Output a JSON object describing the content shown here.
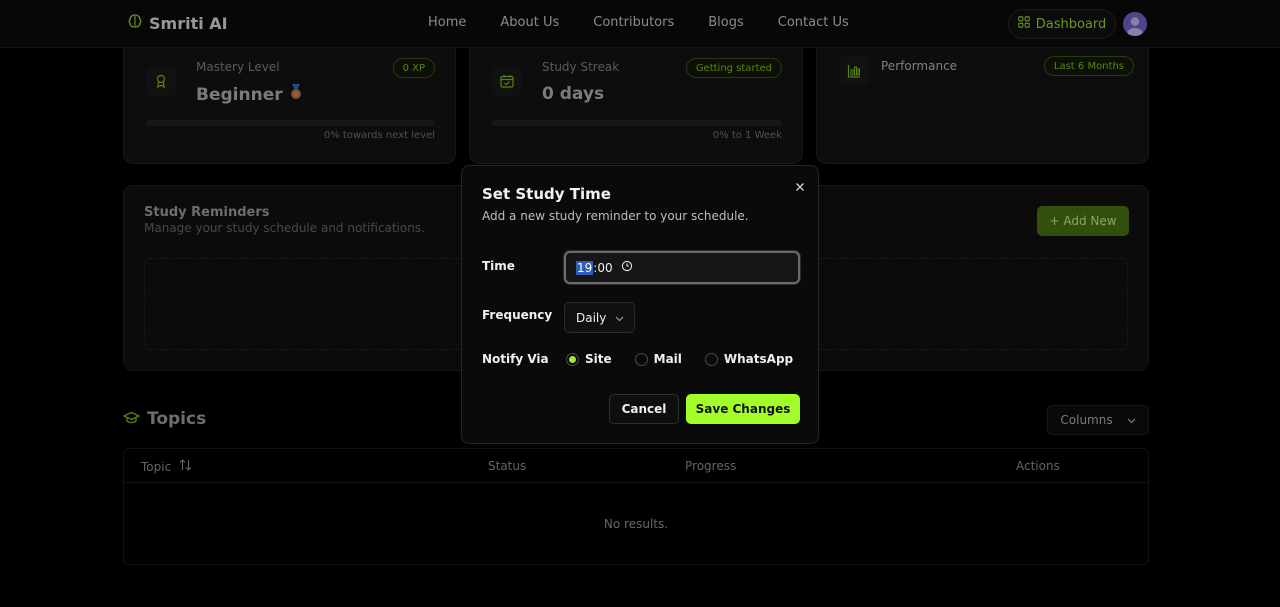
{
  "brand": {
    "name": "Smriti AI"
  },
  "nav": {
    "links": [
      "Home",
      "About Us",
      "Contributors",
      "Blogs",
      "Contact Us"
    ],
    "dashboard_label": "Dashboard"
  },
  "stats": {
    "mastery": {
      "label": "Mastery Level",
      "value": "Beginner",
      "badge": "0 XP",
      "progress": 0,
      "caption": "0% towards next level"
    },
    "streak": {
      "label": "Study Streak",
      "value": "0 days",
      "badge": "Getting started",
      "progress": 0,
      "caption": "0% to 1 Week"
    },
    "performance": {
      "label": "Performance",
      "badge": "Last 6 Months"
    }
  },
  "reminders": {
    "title": "Study Reminders",
    "subtitle": "Manage your study schedule and notifications.",
    "add_label": "+ Add New"
  },
  "topics": {
    "title": "Topics",
    "columns_label": "Columns",
    "headers": {
      "topic": "Topic",
      "status": "Status",
      "progress": "Progress",
      "actions": "Actions"
    },
    "empty": "No results."
  },
  "dialog": {
    "title": "Set Study Time",
    "description": "Add a new study reminder to your schedule.",
    "time_label": "Time",
    "time_hour": "19",
    "time_rest": ":00",
    "frequency_label": "Frequency",
    "frequency_value": "Daily",
    "notify_label": "Notify Via",
    "notify_options": [
      "Site",
      "Mail",
      "WhatsApp"
    ],
    "notify_selected": "Site",
    "cancel_label": "Cancel",
    "save_label": "Save Changes"
  },
  "colors": {
    "accent": "#a3e635",
    "save": "#a3ff2a",
    "add": "#4d7a12"
  }
}
